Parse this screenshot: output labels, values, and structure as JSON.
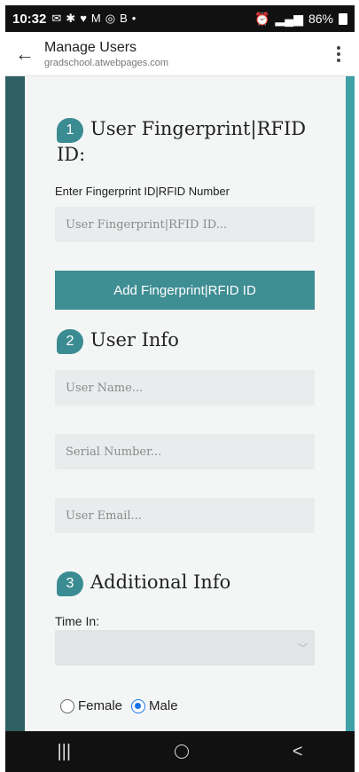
{
  "status_bar": {
    "time": "10:32",
    "left_icons": [
      "✉",
      "✱",
      "♥",
      "M",
      "◎",
      "B",
      "•"
    ],
    "battery": "86%"
  },
  "browser": {
    "title": "Manage Users",
    "url": "gradschool.atwebpages.com"
  },
  "section1": {
    "number": "1",
    "title": "User Fingerprint|RFID ID:",
    "field_label": "Enter Fingerprint ID|RFID Number",
    "placeholder": "User Fingerprint|RFID ID...",
    "button_label": "Add Fingerprint|RFID ID"
  },
  "section2": {
    "number": "2",
    "title": "User Info",
    "name_placeholder": "User Name...",
    "serial_placeholder": "Serial Number...",
    "email_placeholder": "User Email..."
  },
  "section3": {
    "number": "3",
    "title": "Additional Info",
    "time_label": "Time In:",
    "gender_options": [
      "Female",
      "Male"
    ],
    "selected_gender": "Male"
  },
  "nav": {
    "recents": "|||",
    "back": "<"
  },
  "colors": {
    "accent": "#3e8e94",
    "sidebar_dark": "#2e5f62",
    "card_bg": "#f4f6f6",
    "radio_selected": "#1a73e8"
  }
}
